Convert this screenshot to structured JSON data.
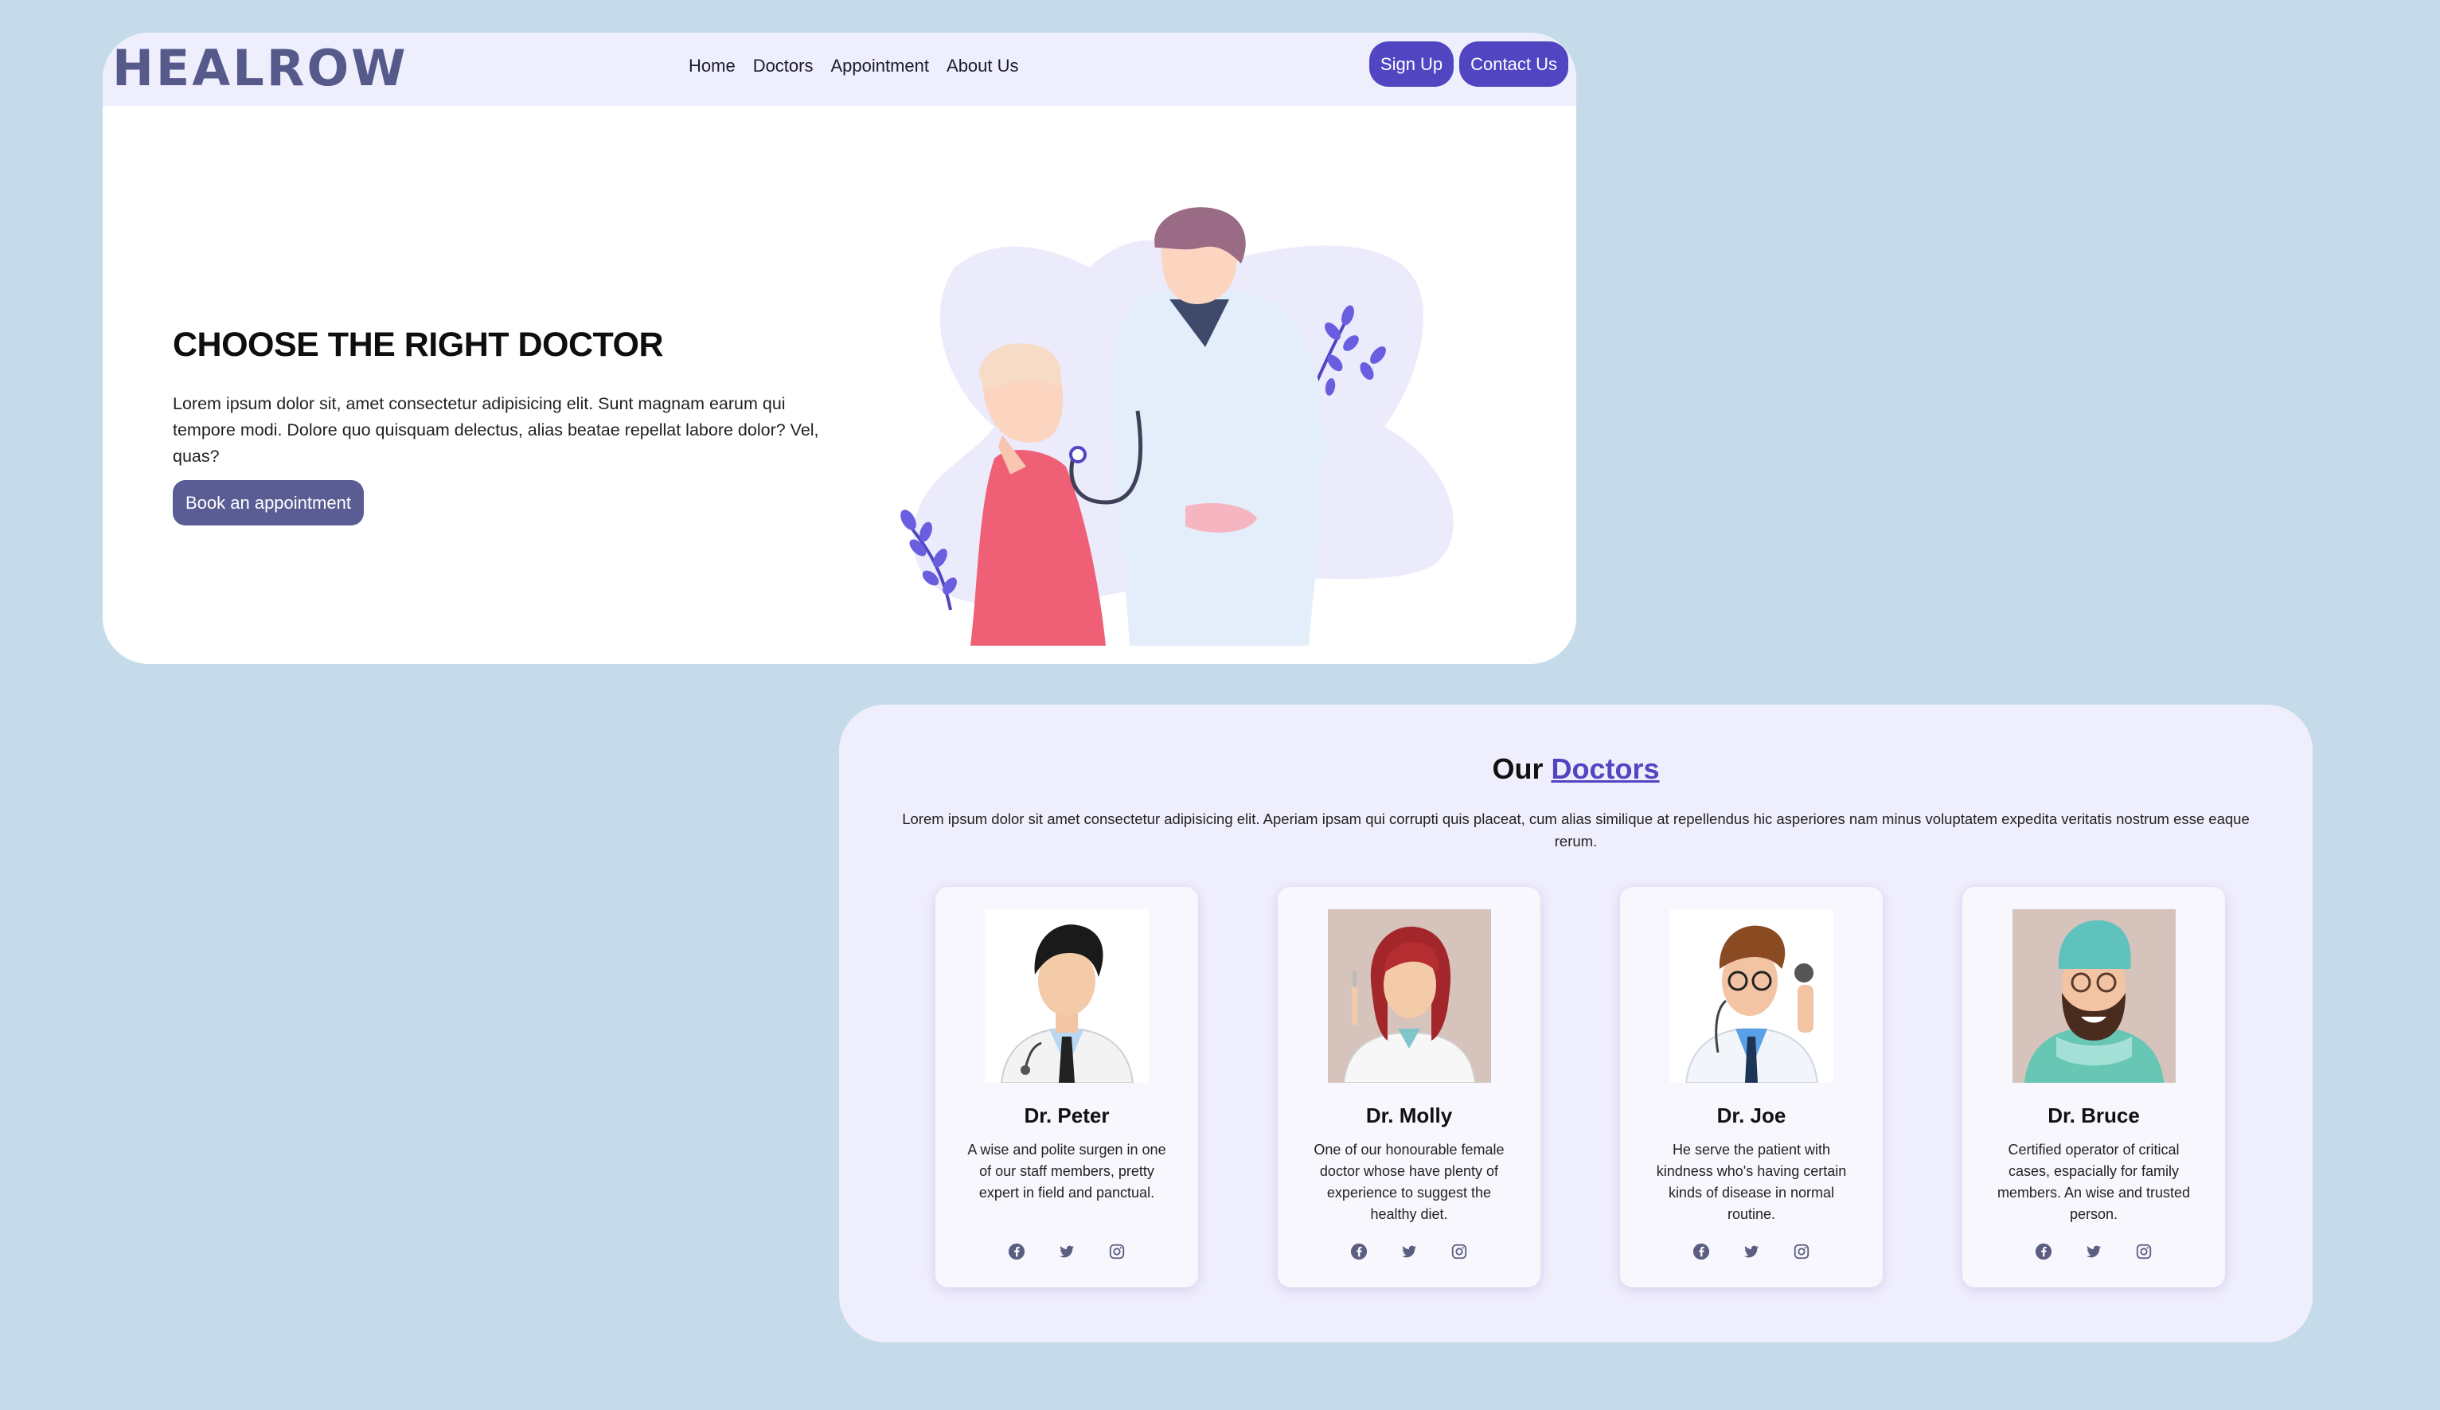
{
  "brand": {
    "logo_text": "HEALROW"
  },
  "nav": {
    "links": [
      "Home",
      "Doctors",
      "Appointment",
      "About Us"
    ],
    "signup_label": "Sign Up",
    "contact_label": "Contact Us"
  },
  "hero": {
    "title": "CHOOSE THE RIGHT DOCTOR",
    "text": "Lorem ipsum dolor sit, amet consectetur adipisicing elit. Sunt magnam earum qui tempore modi. Dolore quo quisquam delectus, alias beatae repellat labore dolor? Vel, quas?",
    "cta_label": "Book an appointment",
    "illustration": "doctor-with-stethoscope-examining-patient"
  },
  "doctors_section": {
    "title_prefix": "Our",
    "title_accent": "Doctors",
    "description": "Lorem ipsum dolor sit amet consectetur adipisicing elit. Aperiam ipsam qui corrupti quis placeat, cum alias similique at repellendus hic asperiores nam minus voluptatem expedita veritatis nostrum esse eaque rerum.",
    "doctors": [
      {
        "name": "Dr. Peter",
        "bio": "A wise and polite surgen in one of our staff members, pretty expert in field and panctual.",
        "avatar": "male-doctor-black-hair-avatar"
      },
      {
        "name": "Dr. Molly",
        "bio": "One of our honourable female doctor whose have plenty of experience to suggest the healthy diet.",
        "avatar": "female-doctor-red-hair-avatar"
      },
      {
        "name": "Dr. Joe",
        "bio": "He serve the patient with kindness who's having certain kinds of disease in normal routine.",
        "avatar": "male-doctor-glasses-stethoscope-avatar"
      },
      {
        "name": "Dr. Bruce",
        "bio": "Certified operator of critical cases, espacially for family members. An wise and trusted person.",
        "avatar": "bearded-surgeon-scrubs-avatar"
      }
    ],
    "social_icons": [
      "facebook-icon",
      "twitter-icon",
      "instagram-icon"
    ]
  },
  "colors": {
    "page_background": "#c6dbe9",
    "navbar_background": "#efeefc",
    "accent": "#5145c2",
    "logo": "#565a8b",
    "hero_button": "#595d94",
    "social_icon": "#5b5e80"
  }
}
